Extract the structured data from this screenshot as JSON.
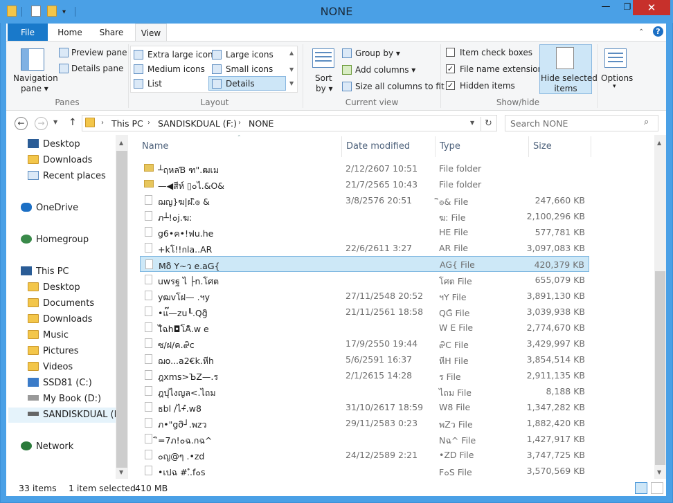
{
  "window": {
    "title": "NONE",
    "minimize": "—",
    "maximize": "❐",
    "close": "✕"
  },
  "ribbon": {
    "tabs": [
      "File",
      "Home",
      "Share",
      "View"
    ],
    "panes": {
      "navigation_pane": "Navigation",
      "navigation_pane2": "pane ▾",
      "preview_pane": "Preview pane",
      "details_pane": "Details pane",
      "label": "Panes"
    },
    "layout": {
      "items": [
        "Extra large icons",
        "Large icons",
        "Medium icons",
        "Small icons",
        "List",
        "Details"
      ],
      "label": "Layout"
    },
    "current_view": {
      "sort_by": "Sort",
      "sort_by2": "by ▾",
      "group_by": "Group by ▾",
      "add_columns": "Add columns ▾",
      "size_all": "Size all columns to fit",
      "label": "Current view"
    },
    "show_hide": {
      "item_check_boxes": "Item check boxes",
      "file_name_extensions": "File name extensions",
      "hidden_items": "Hidden items",
      "hide_selected": "Hide selected",
      "hide_selected2": "items",
      "label": "Show/hide",
      "checked": [
        "File name extensions",
        "Hidden items"
      ]
    },
    "options": {
      "label": "Options",
      "label2": "▾"
    }
  },
  "address": {
    "crumbs": [
      "This PC",
      "SANDISKDUAL (F:)",
      "NONE"
    ],
    "search_placeholder": "Search NONE"
  },
  "nav_pane": {
    "quick": [
      "Desktop",
      "Downloads",
      "Recent places"
    ],
    "onedrive": "OneDrive",
    "homegroup": "Homegroup",
    "thispc": "This PC",
    "pc_items": [
      "Desktop",
      "Documents",
      "Downloads",
      "Music",
      "Pictures",
      "Videos",
      "SSD81 (C:)",
      "My Book (D:)",
      "SANDISKDUAL (F:)"
    ],
    "network": "Network"
  },
  "columns": {
    "name": "Name",
    "date": "Date modified",
    "type": "Type",
    "size": "Size"
  },
  "files": [
    {
      "name": "┴ฤหลƁ ฑ\".ฒเม",
      "date": "2/12/2607 10:51",
      "type": "File folder",
      "size": "",
      "folder": true
    },
    {
      "name": "—◀สีห์ ▯๐ไ.&O&",
      "date": "21/7/2565 10:43",
      "type": "File folder",
      "size": "",
      "folder": true
    },
    {
      "name": "ฌญ}ฆ|ฝ.ิ๏ &",
      "date": "3/8/2576 20:51",
      "type": "ิ๏& File",
      "size": "247,660 KB"
    },
    {
      "name": "ภ┴!๐j.ฆ:",
      "date": "",
      "type": "ฆ: File",
      "size": "2,100,296 KB"
    },
    {
      "name": "g6•ค•!ฟu.he",
      "date": "",
      "type": "HE File",
      "size": "577,781 KB"
    },
    {
      "name": "+kโ!!กla..AR",
      "date": "22/6/2611 3:27",
      "type": "AR File",
      "size": "3,097,083 KB"
    },
    {
      "name": "Moิ Y~ว e.aG{",
      "date": "",
      "type": "AG{ File",
      "size": "420,379 KB",
      "selected": true
    },
    {
      "name": "uwรฐ ไ ├n.โศต",
      "date": "",
      "type": "โศต File",
      "size": "655,079 KB"
    },
    {
      "name": "yฒvโฝ— .ฯy",
      "date": "27/11/2548 20:52",
      "type": "ฯY File",
      "size": "3,891,130 KB"
    },
    {
      "name": "•แ๊—zu┖.Qgิ",
      "date": "21/11/2561 18:58",
      "type": "QGิ File",
      "size": "3,039,938 KB"
    },
    {
      "name": "ไัฉh◘โAิ.w e",
      "date": "",
      "type": "W E File",
      "size": "2,774,670 KB"
    },
    {
      "name": "ซ/ฝ/ค.๙ิc",
      "date": "17/9/2550 19:44",
      "type": "๙ิC File",
      "size": "3,429,997 KB"
    },
    {
      "name": "ฌo...a2€k.หีh",
      "date": "5/6/2591 16:37",
      "type": "หีH File",
      "size": "3,854,514 KB"
    },
    {
      "name": "ฎxms>ЪZ—.ร",
      "date": "2/1/2615 14:28",
      "type": "ร File",
      "size": "2,911,135 KB"
    },
    {
      "name": "ฎปุไงญล<.ไถม",
      "date": "",
      "type": "ไถม File",
      "size": "8,188 KB"
    },
    {
      "name": "ธbl /ไ+ํ.w8",
      "date": "31/10/2617 18:59",
      "type": "W8 File",
      "size": "1,347,282 KB"
    },
    {
      "name": "ภ•\"gσิ┘.พzว",
      "date": "29/11/2583 0:23",
      "type": "พZว File",
      "size": "1,882,420 KB"
    },
    {
      "name": "ิ=7ภ!๐ฉ.กฉ^",
      "date": "",
      "type": "Nฉ^ File",
      "size": "1,427,917 KB"
    },
    {
      "name": "๐ญ@ๆ .•zd",
      "date": "24/12/2589 2:21",
      "type": "•ZD File",
      "size": "3,747,725 KB"
    },
    {
      "name": "•เปฉ #.ํ.f๐s",
      "date": "",
      "type": "F๐S File",
      "size": "3,570,569 KB"
    }
  ],
  "status": {
    "count": "33 items",
    "selected": "1 item selected",
    "size": "410 MB"
  }
}
